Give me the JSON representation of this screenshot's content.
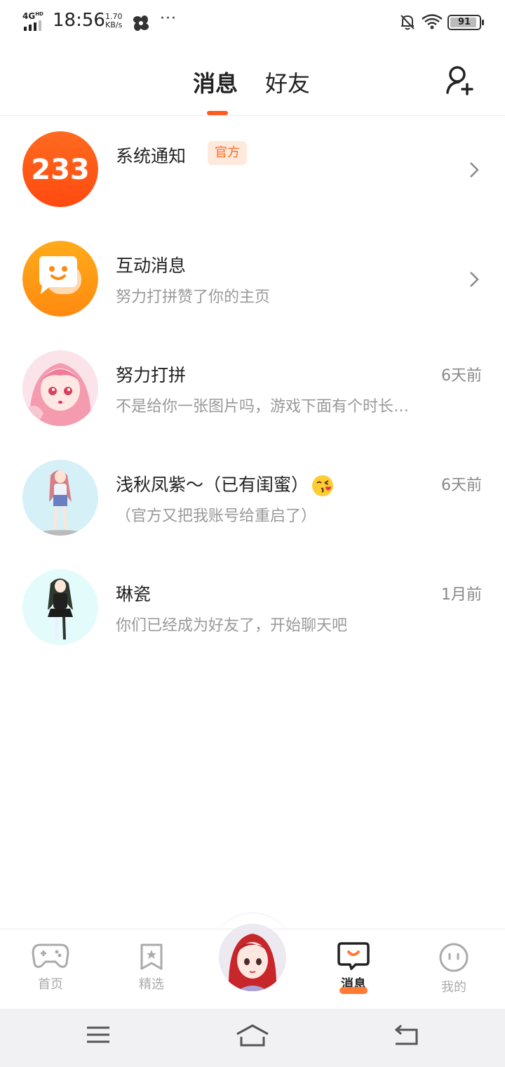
{
  "status_bar": {
    "network": "4G",
    "network_sup": "HD",
    "time": "18:56",
    "speed_value": "1.70",
    "speed_unit": "KB/s",
    "more": "···",
    "battery": "91"
  },
  "header": {
    "tabs": [
      {
        "label": "消息",
        "active": true
      },
      {
        "label": "好友",
        "active": false
      }
    ],
    "accent_color": "#ff5a1f"
  },
  "conversations": [
    {
      "title": "系统通知",
      "badge": "官方",
      "subtitle": "",
      "time": "",
      "has_chevron": true,
      "avatar": "233-logo"
    },
    {
      "title": "互动消息",
      "subtitle": "努力打拼赞了你的主页",
      "time": "",
      "has_chevron": true,
      "avatar": "chat-face-logo"
    },
    {
      "title": "努力打拼",
      "subtitle": "不是给你一张图片吗，游戏下面有个时长…",
      "time": "6天前",
      "avatar": "pink-anime-girl"
    },
    {
      "title": "浅秋凤紫～（已有闺蜜）",
      "subtitle": "（官方又把我账号给重启了）",
      "time": "6天前",
      "avatar": "pink-hair-character"
    },
    {
      "title": "琳瓷",
      "subtitle": "你们已经成为好友了，开始聊天吧",
      "time": "1月前",
      "avatar": "dark-hair-character"
    }
  ],
  "logo_233": "233",
  "bottom_nav": {
    "items": [
      {
        "label": "首页",
        "icon": "gamepad-icon"
      },
      {
        "label": "精选",
        "icon": "star-bookmark-icon"
      },
      {
        "label": "消息",
        "icon": "message-bubble-icon",
        "active": true
      },
      {
        "label": "我的",
        "icon": "face-icon"
      }
    ]
  }
}
